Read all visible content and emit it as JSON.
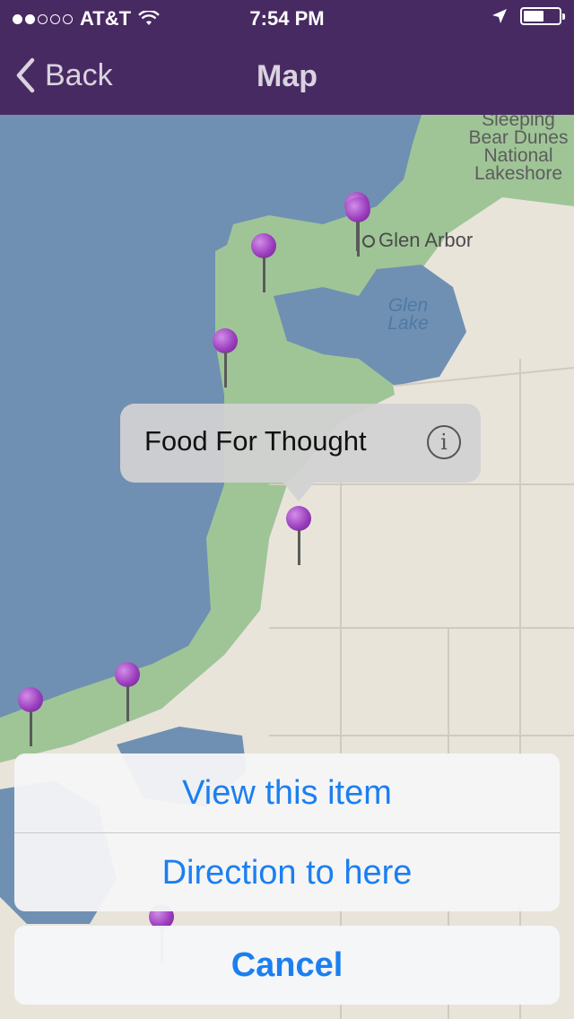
{
  "status": {
    "carrier": "AT&T",
    "time": "7:54 PM"
  },
  "nav": {
    "back_label": "Back",
    "title": "Map"
  },
  "map": {
    "labels": {
      "park": "Sleeping Bear Dunes National Lakeshore",
      "town": "Glen Arbor",
      "lake": "Glen Lake"
    }
  },
  "callout": {
    "title": "Food For Thought",
    "info_symbol": "i"
  },
  "action_sheet": {
    "view_item": "View this item",
    "directions": "Direction to here",
    "cancel": "Cancel"
  },
  "colors": {
    "nav_bg": "#482a63",
    "water": "#6f90b2",
    "land_green": "#9fc597",
    "land_grey": "#e8e4da",
    "pin": "#9c3fbf",
    "action_text": "#1b7ff0"
  }
}
